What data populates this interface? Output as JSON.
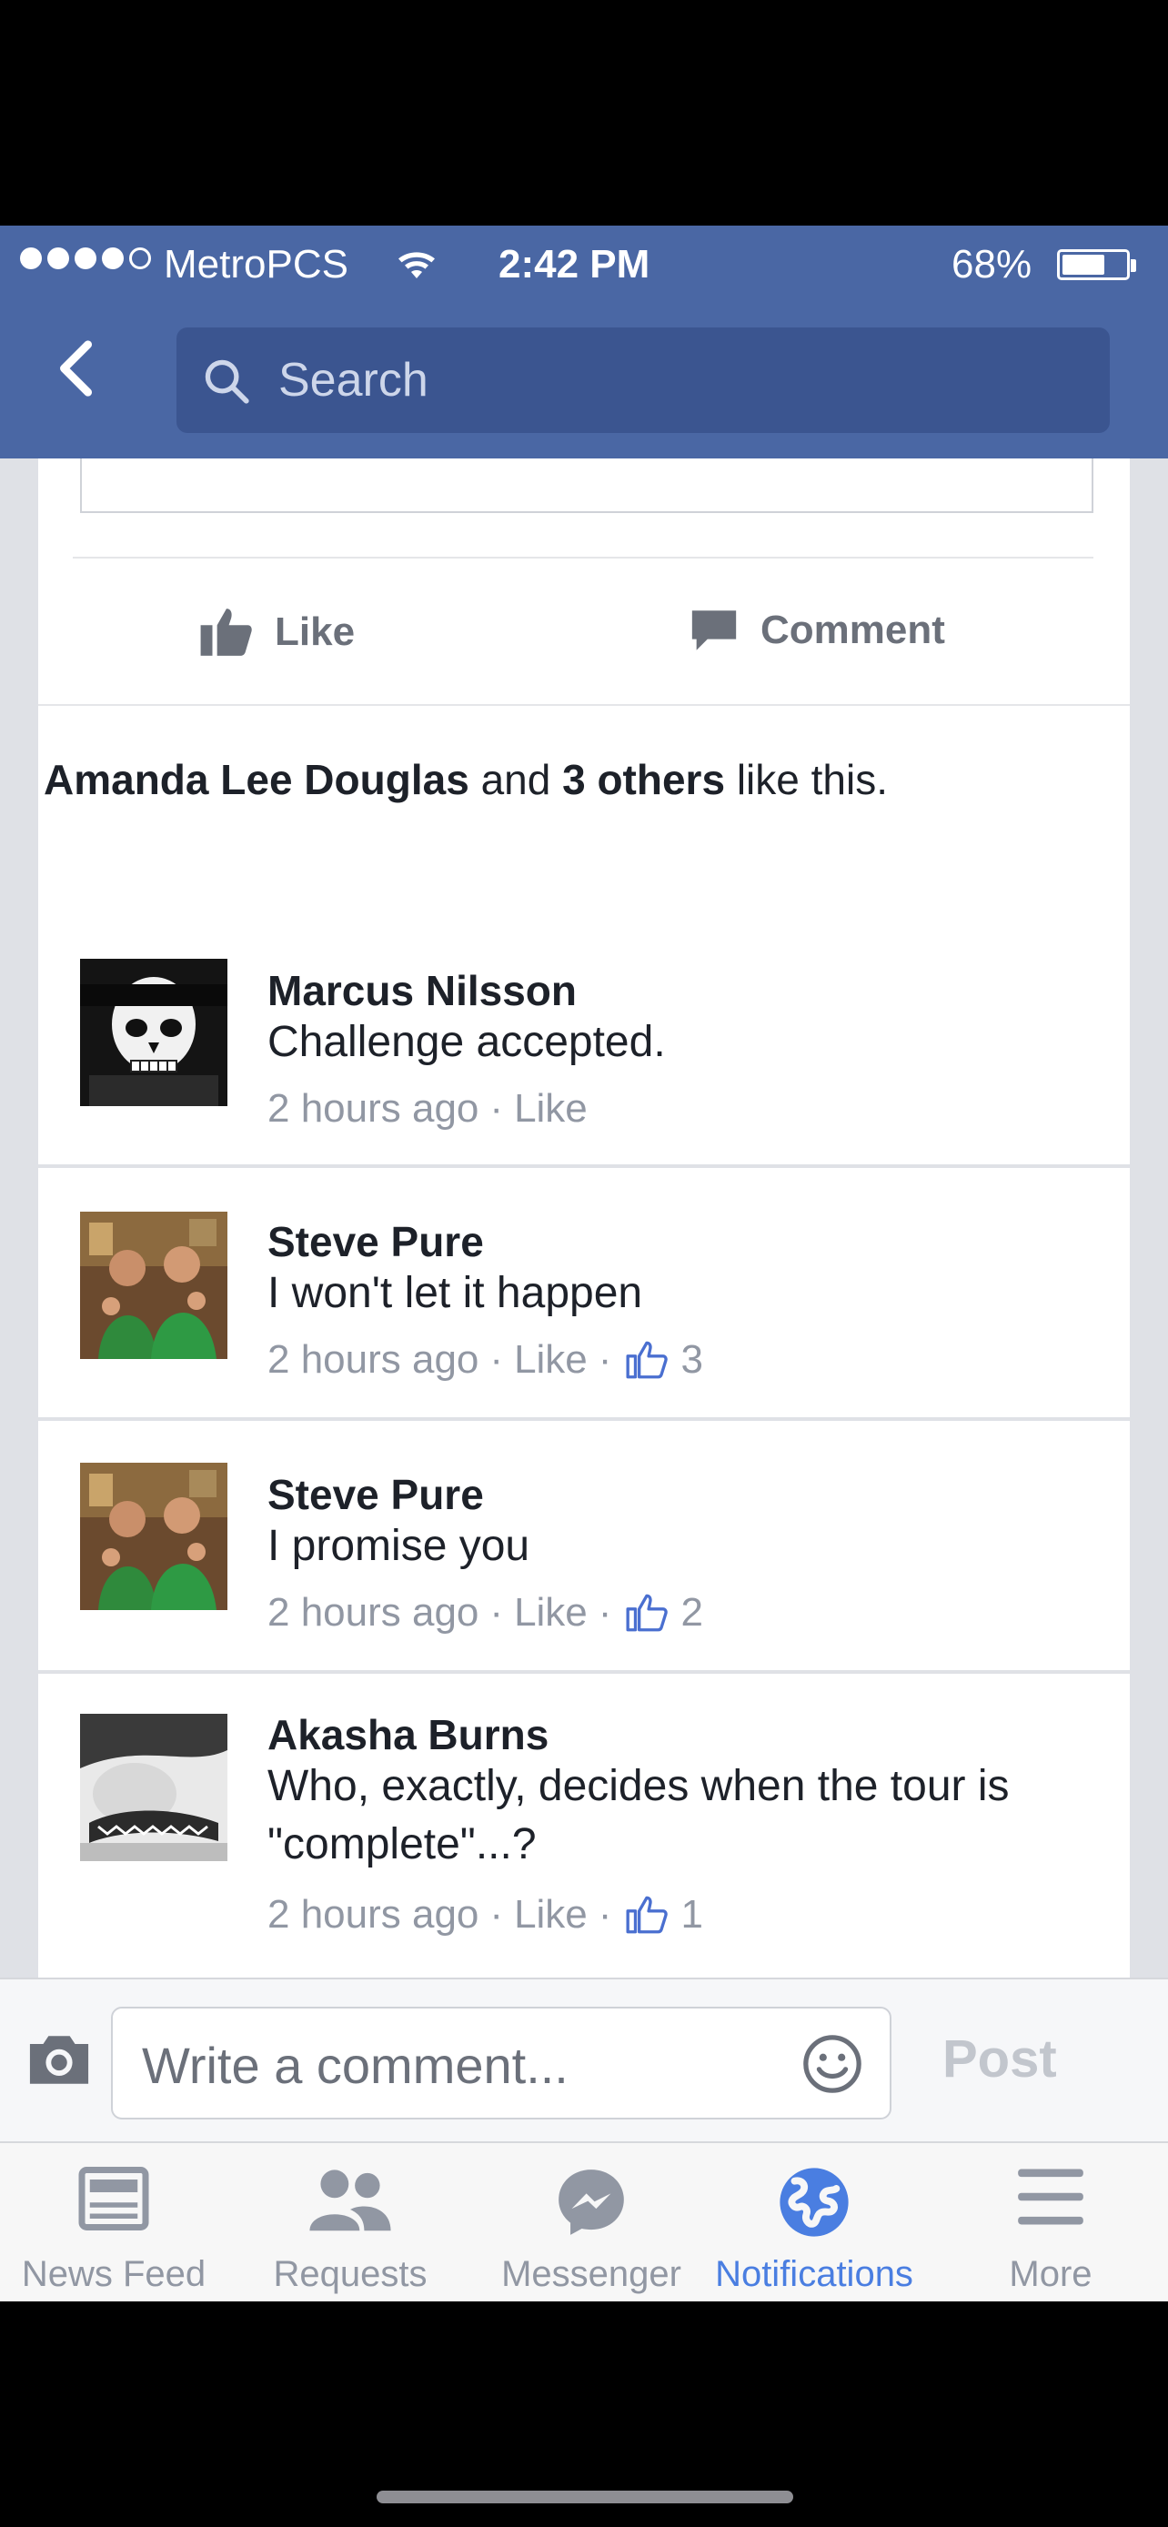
{
  "status_bar": {
    "carrier": "MetroPCS",
    "time": "2:42 PM",
    "battery_percent_label": "68%",
    "battery_level": 0.68,
    "signal_dots_filled": 4
  },
  "nav": {
    "back_icon": "chevron-left-icon",
    "search_placeholder": "Search"
  },
  "post_actions": {
    "like_label": "Like",
    "comment_label": "Comment"
  },
  "likes_summary": {
    "name": "Amanda Lee Douglas",
    "joiner": "and",
    "others": "3 others",
    "suffix": "like this."
  },
  "comments": [
    {
      "author": "Marcus Nilsson",
      "text": "Challenge accepted.",
      "time": "2 hours ago",
      "like_label": "Like",
      "likes": ""
    },
    {
      "author": "Steve Pure",
      "text": "I won't let it happen",
      "time": "2 hours ago",
      "like_label": "Like",
      "likes": "3"
    },
    {
      "author": "Steve Pure",
      "text": "I promise you",
      "time": "2 hours ago",
      "like_label": "Like",
      "likes": "2"
    },
    {
      "author": "Akasha Burns",
      "text": "Who, exactly, decides when the tour is \"complete\"...?",
      "time": "2 hours ago",
      "like_label": "Like",
      "likes": "1"
    }
  ],
  "compose": {
    "placeholder": "Write a comment...",
    "post_label": "Post"
  },
  "tabs": [
    {
      "label": "News Feed",
      "icon": "news-feed-icon",
      "active": false
    },
    {
      "label": "Requests",
      "icon": "friends-icon",
      "active": false
    },
    {
      "label": "Messenger",
      "icon": "messenger-icon",
      "active": false
    },
    {
      "label": "Notifications",
      "icon": "globe-icon",
      "active": true
    },
    {
      "label": "More",
      "icon": "menu-icon",
      "active": false
    }
  ],
  "colors": {
    "header_blue": "#4a67a4",
    "active_tab": "#4a7ee1",
    "meta_gray": "#9197a3"
  }
}
